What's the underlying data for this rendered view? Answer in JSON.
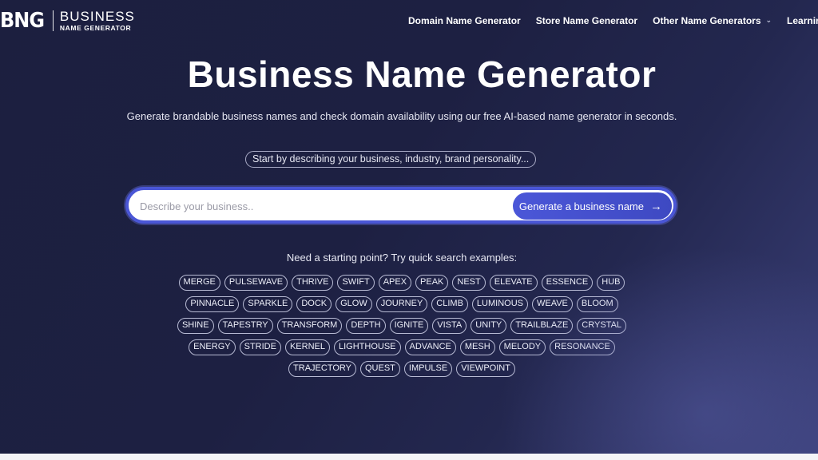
{
  "header": {
    "logo_mark": "BNG",
    "logo_line1": "BUSINESS",
    "logo_line2": "NAME GENERATOR",
    "nav": [
      {
        "label": "Domain Name Generator",
        "has_dropdown": false
      },
      {
        "label": "Store Name Generator",
        "has_dropdown": false
      },
      {
        "label": "Other Name Generators",
        "has_dropdown": true
      },
      {
        "label": "Learning",
        "has_dropdown": false
      }
    ]
  },
  "hero": {
    "title": "Business Name Generator",
    "subtitle": "Generate brandable business names and check domain availability using our free AI-based name generator in seconds.",
    "hint": "Start by describing your business, industry, brand personality..."
  },
  "search": {
    "placeholder": "Describe your business..",
    "value": "",
    "button_label": "Generate a business name",
    "button_icon": "arrow-right-icon"
  },
  "examples": {
    "label": "Need a starting point? Try quick search examples:",
    "tags": [
      "MERGE",
      "PULSEWAVE",
      "THRIVE",
      "SWIFT",
      "APEX",
      "PEAK",
      "NEST",
      "ELEVATE",
      "ESSENCE",
      "HUB",
      "PINNACLE",
      "SPARKLE",
      "DOCK",
      "GLOW",
      "JOURNEY",
      "CLIMB",
      "LUMINOUS",
      "WEAVE",
      "BLOOM",
      "SHINE",
      "TAPESTRY",
      "TRANSFORM",
      "DEPTH",
      "IGNITE",
      "VISTA",
      "UNITY",
      "TRAILBLAZE",
      "CRYSTAL",
      "ENERGY",
      "STRIDE",
      "KERNEL",
      "LIGHTHOUSE",
      "ADVANCE",
      "MESH",
      "MELODY",
      "RESONANCE",
      "TRAJECTORY",
      "QUEST",
      "IMPULSE",
      "VIEWPOINT"
    ]
  },
  "colors": {
    "background": "#1d2042",
    "accent": "#4a56d6",
    "text": "#ffffff"
  }
}
